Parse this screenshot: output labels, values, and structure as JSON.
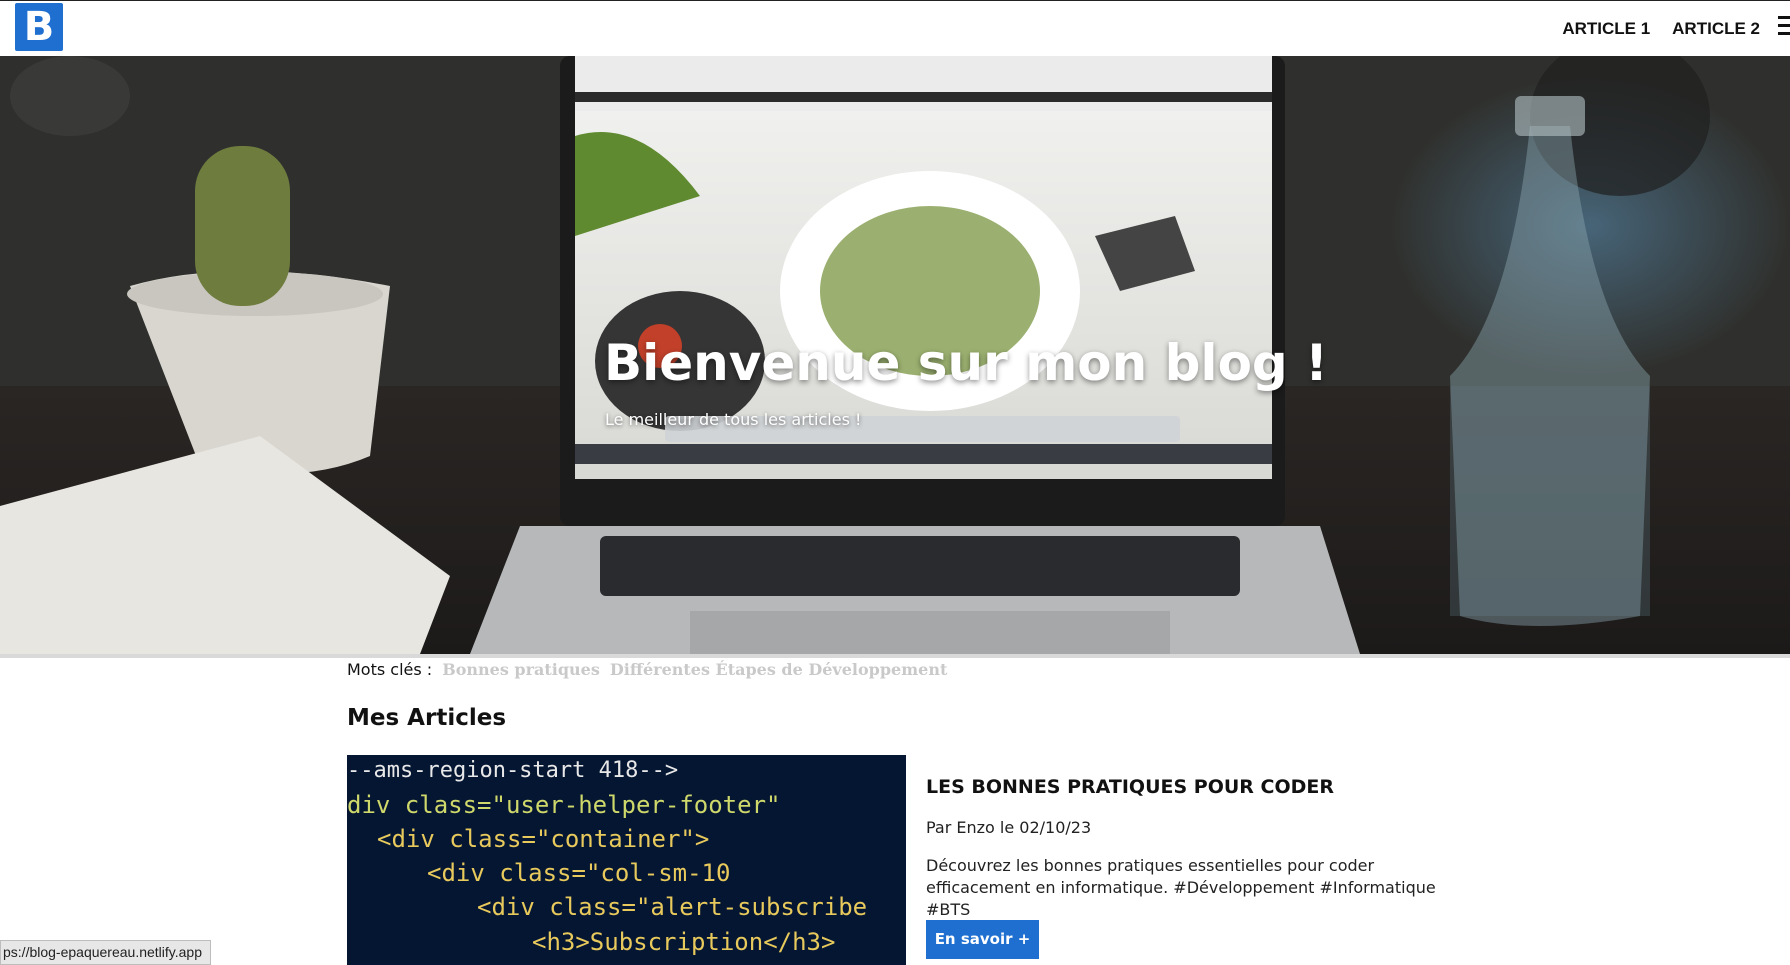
{
  "logo": {
    "letter": "B"
  },
  "nav": {
    "links": [
      "ARTICLE 1",
      "ARTICLE 2"
    ]
  },
  "hero": {
    "title": "Bienvenue sur mon blog !",
    "subtitle": "Le meilleur de tous les articles !"
  },
  "tags": {
    "label": "Mots clés :",
    "items": [
      "Bonnes pratiques",
      "Différentes Étapes de Développement"
    ]
  },
  "articles_section": {
    "title": "Mes Articles"
  },
  "article": {
    "title": "LES BONNES PRATIQUES POUR CODER",
    "meta": "Par Enzo le 02/10/23",
    "description": "Découvrez les bonnes pratiques essentielles pour coder efficacement en informatique. #Développement #Informatique #BTS",
    "button_label": "En savoir +",
    "code_lines": [
      "--ams-region-start 418-->",
      "div class=\"user-helper-footer\"",
      "<div class=\"container\">",
      "<div class=\"col-sm-10",
      "<div class=\"alert-subscribe",
      "<h3>Subscription</h3>"
    ]
  },
  "status_url": "ps://blog-epaquereau.netlify.app",
  "colors": {
    "accent": "#1e6fd0",
    "tag": "#c9c9c9"
  }
}
